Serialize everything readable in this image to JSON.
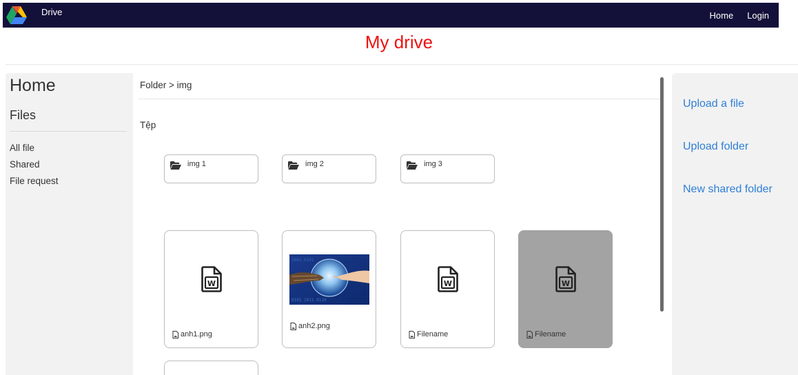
{
  "navbar": {
    "brand": "Drive",
    "links": [
      "Home",
      "Login"
    ],
    "background_color": "#13113a"
  },
  "page": {
    "title": "My drive",
    "title_color": "#ee1111"
  },
  "left_sidebar": {
    "heading": "Home",
    "subheading": "Files",
    "items": [
      "All file",
      "Shared",
      "File request"
    ]
  },
  "main": {
    "breadcrumb": "Folder > img",
    "section_label": "Tệp",
    "folders": [
      {
        "name": "img 1",
        "icon": "folder-open-icon"
      },
      {
        "name": "img 2",
        "icon": "folder-open-icon"
      },
      {
        "name": "img 3",
        "icon": "folder-open-icon"
      }
    ],
    "files": [
      {
        "name": "anh1.png",
        "preview": "word-file-icon",
        "selected": false
      },
      {
        "name": "anh2.png",
        "preview": "image-thumbnail",
        "selected": false
      },
      {
        "name": "Filename",
        "preview": "word-file-icon",
        "selected": false
      },
      {
        "name": "Filename",
        "preview": "word-file-icon",
        "selected": true
      }
    ]
  },
  "right_sidebar": {
    "actions": [
      "Upload a file",
      "Upload folder",
      "New shared folder"
    ],
    "link_color": "#2f7fd6"
  }
}
